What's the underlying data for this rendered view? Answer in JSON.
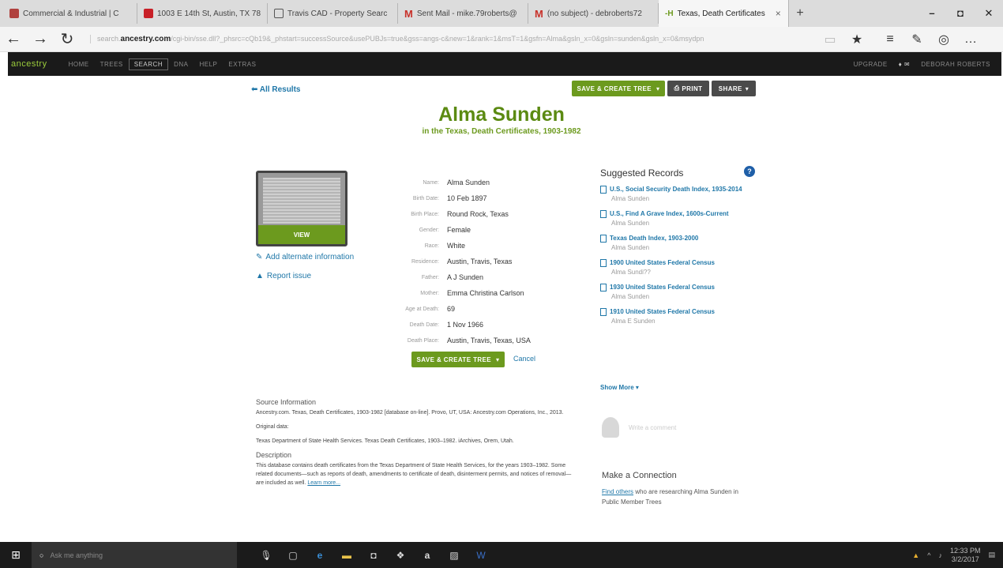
{
  "browser": {
    "tabs": [
      {
        "label": "Commercial & Industrial | C",
        "color": "#b0413e"
      },
      {
        "label": "1003 E 14th St, Austin, TX 78",
        "color": "#c82027"
      },
      {
        "label": "Travis CAD - Property Searc",
        "color": "#555"
      },
      {
        "label": "Sent Mail - mike.79roberts@",
        "color": "#c8312a"
      },
      {
        "label": "(no subject) - debroberts72",
        "color": "#c8312a"
      },
      {
        "label": "Texas, Death Certificates",
        "color": "#6c9a1e"
      }
    ],
    "url_prefix": "search.",
    "url_host": "ancestry.com",
    "url_rest": "/cgi-bin/sse.dll?_phsrc=cQb19&_phstart=successSource&usePUBJs=true&gss=angs-c&new=1&rank=1&msT=1&gsfn=Alma&gsln_x=0&gsln=sunden&gsln_x=0&msydpn"
  },
  "ancestry_nav": {
    "logo": "ancestry",
    "items": [
      "HOME",
      "TREES",
      "SEARCH",
      "DNA",
      "HELP",
      "EXTRAS"
    ],
    "upgrade": "UPGRADE",
    "user": "DEBORAH ROBERTS"
  },
  "page": {
    "back": "All Results",
    "save_tree": "SAVE & CREATE TREE",
    "print": "PRINT",
    "share": "SHARE",
    "title": "Alma Sunden",
    "subtitle": "in the Texas, Death Certificates, 1903-1982",
    "view": "VIEW",
    "add_alt": "Add alternate information",
    "report": "Report issue",
    "fields": [
      {
        "label": "Name:",
        "value": "Alma Sunden"
      },
      {
        "label": "Birth Date:",
        "value": "10 Feb 1897"
      },
      {
        "label": "Birth Place:",
        "value": "Round Rock, Texas"
      },
      {
        "label": "Gender:",
        "value": "Female"
      },
      {
        "label": "Race:",
        "value": "White"
      },
      {
        "label": "Residence:",
        "value": "Austin, Travis, Texas"
      },
      {
        "label": "Father:",
        "value": "A J Sunden"
      },
      {
        "label": "Mother:",
        "value": "Emma Christina Carlson"
      },
      {
        "label": "Age at Death:",
        "value": "69"
      },
      {
        "label": "Death Date:",
        "value": "1 Nov 1966"
      },
      {
        "label": "Death Place:",
        "value": "Austin, Travis, Texas, USA"
      }
    ],
    "cancel": "Cancel",
    "suggested_title": "Suggested Records",
    "suggested": [
      {
        "title": "U.S., Social Security Death Index, 1935-2014",
        "name": "Alma Sunden"
      },
      {
        "title": "U.S., Find A Grave Index, 1600s-Current",
        "name": "Alma Sunden"
      },
      {
        "title": "Texas Death Index, 1903-2000",
        "name": "Alma Sunden"
      },
      {
        "title": "1900 United States Federal Census",
        "name": "Alma Sundi??"
      },
      {
        "title": "1930 United States Federal Census",
        "name": "Alma Sunden"
      },
      {
        "title": "1910 United States Federal Census",
        "name": "Alma E Sunden"
      }
    ],
    "show_more": "Show More",
    "source_title": "Source Information",
    "source_text": "Ancestry.com. Texas, Death Certificates, 1903-1982 [database on-line]. Provo, UT, USA: Ancestry.com Operations, Inc., 2013.",
    "orig_title": "Original data:",
    "orig_text": "Texas Department of State Health Services. Texas Death Certificates, 1903–1982. iArchives, Orem, Utah.",
    "desc_title": "Description",
    "desc_text": "This database contains death certificates from the Texas Department of State Health Services, for the years 1903–1982. Some related documents—such as reports of death, amendments to certificate of death, disinterment permits, and notices of removal—are included as well.",
    "learn_more": "Learn more...",
    "comment_placeholder": "Write a comment",
    "connect_title": "Make a Connection",
    "find_others": "Find others",
    "connect_text": " who are researching Alma Sunden in Public Member Trees"
  },
  "taskbar": {
    "search": "Ask me anything",
    "time": "12:33 PM",
    "date": "3/2/2017"
  }
}
